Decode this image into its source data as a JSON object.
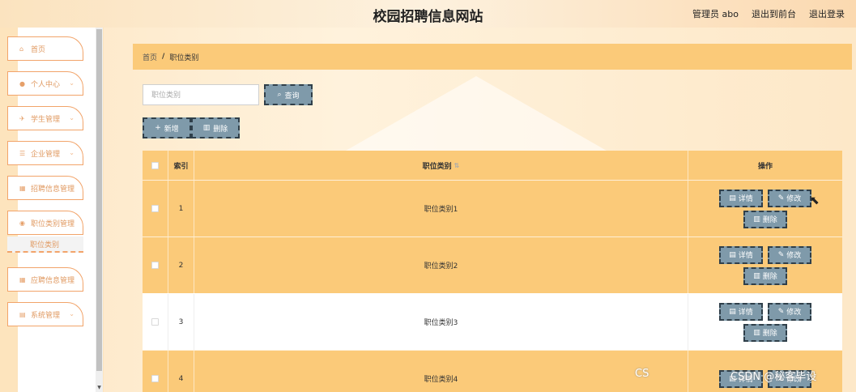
{
  "header": {
    "site_title": "校园招聘信息网站",
    "admin_label": "管理员 abo",
    "back_front": "退出到前台",
    "logout": "退出登录"
  },
  "sidebar": {
    "items": [
      {
        "label": "首页",
        "icon": "home-icon",
        "has_chevron": false
      },
      {
        "label": "个人中心",
        "icon": "user-icon",
        "has_chevron": true
      },
      {
        "label": "学生管理",
        "icon": "student-icon",
        "has_chevron": true
      },
      {
        "label": "企业管理",
        "icon": "company-icon",
        "has_chevron": true
      },
      {
        "label": "招聘信息管理",
        "icon": "grid-icon",
        "has_chevron": true
      },
      {
        "label": "职位类别管理",
        "icon": "location-icon",
        "has_chevron": true
      },
      {
        "label": "应聘信息管理",
        "icon": "grid-icon",
        "has_chevron": true
      },
      {
        "label": "系统管理",
        "icon": "settings-icon",
        "has_chevron": true
      }
    ],
    "sub_item": "职位类别"
  },
  "breadcrumb": {
    "home": "首页",
    "separator": "/",
    "current": "职位类别"
  },
  "search": {
    "placeholder": "职位类别",
    "button": "查询"
  },
  "actions": {
    "add": "新增",
    "delete": "删除"
  },
  "table": {
    "headers": {
      "index": "索引",
      "name": "职位类别",
      "ops": "操作"
    },
    "rows": [
      {
        "index": "1",
        "name": "职位类别1"
      },
      {
        "index": "2",
        "name": "职位类别2"
      },
      {
        "index": "3",
        "name": "职位类别3"
      },
      {
        "index": "4",
        "name": "职位类别4"
      }
    ],
    "row_buttons": {
      "detail": "详情",
      "edit": "修改",
      "delete": "删除"
    }
  },
  "watermark": "CSDN @秘客毕设",
  "watermark_small": "CS",
  "colors": {
    "accent": "#fbca79",
    "button": "#7f9aaa",
    "menu_text": "#e09a62"
  }
}
